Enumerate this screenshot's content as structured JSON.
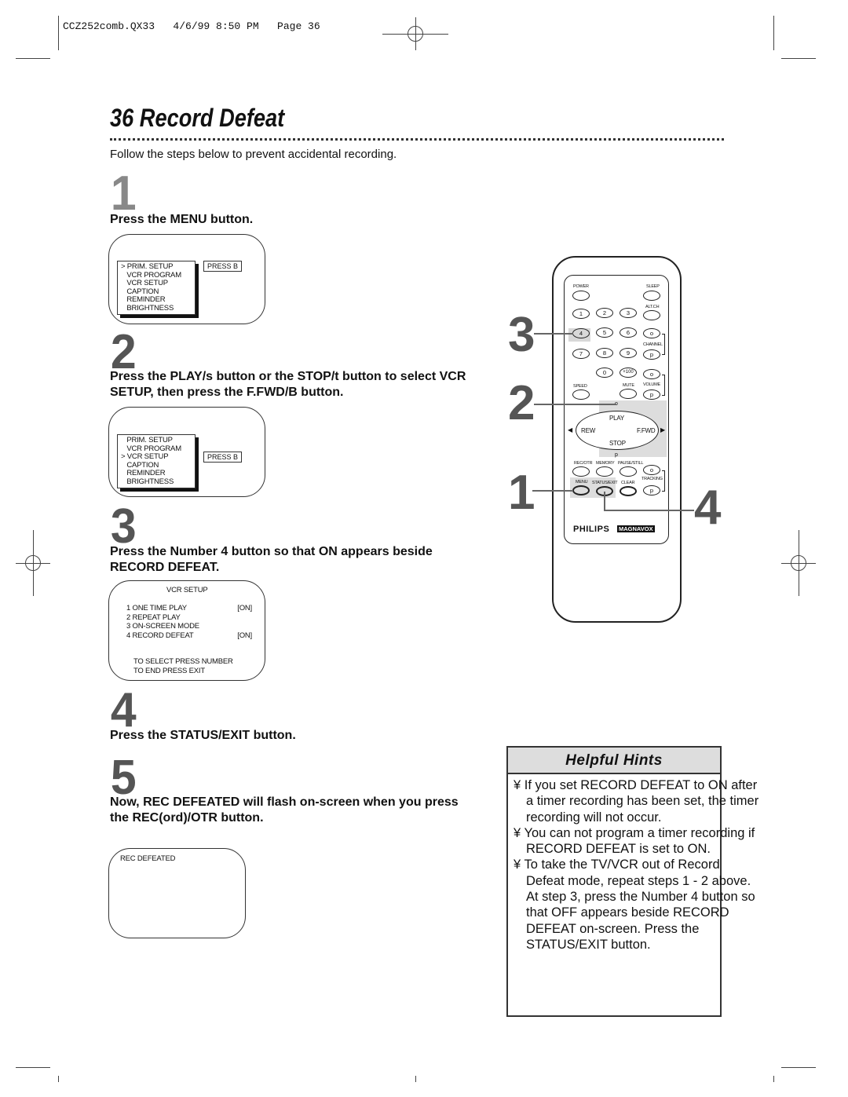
{
  "slug": "CCZ252comb.QX33   4/6/99 8:50 PM   Page 36",
  "title": "36  Record Defeat",
  "intro": "Follow the steps below to prevent accidental recording.",
  "steps": [
    {
      "num": "1",
      "text": "Press the MENU button."
    },
    {
      "num": "2",
      "text": "Press the PLAY/s  button or the STOP/t  button to select VCR SETUP, then press the F.FWD/B  button."
    },
    {
      "num": "3",
      "text": "Press the Number 4 button so that ON appears beside RECORD DEFEAT."
    },
    {
      "num": "4",
      "text": "Press the STATUS/EXIT button."
    },
    {
      "num": "5",
      "text": "Now, REC DEFEATED will flash on-screen when you press the REC(ord)/OTR button."
    }
  ],
  "screen1": {
    "items": [
      "> PRIM. SETUP",
      "   VCR PROGRAM",
      "   VCR SETUP",
      "   CAPTION",
      "   REMINDER",
      "   BRIGHTNESS"
    ],
    "press": "PRESS B"
  },
  "screen2": {
    "items": [
      "   PRIM. SETUP",
      "   VCR PROGRAM",
      "> VCR SETUP",
      "   CAPTION",
      "   REMINDER",
      "   BRIGHTNESS"
    ],
    "press": "PRESS B"
  },
  "screen3": {
    "title": "VCR SETUP",
    "rows": [
      {
        "label": "1  ONE TIME PLAY",
        "value": "[ON]"
      },
      {
        "label": "2  REPEAT PLAY",
        "value": ""
      },
      {
        "label": "3  ON-SCREEN MODE",
        "value": ""
      },
      {
        "label": "4  RECORD DEFEAT",
        "value": "[ON]"
      }
    ],
    "footer1": "TO SELECT PRESS NUMBER",
    "footer2": "TO END PRESS EXIT"
  },
  "screen5": {
    "text": "REC DEFEATED"
  },
  "hints": {
    "title": "Helpful Hints",
    "items": [
      "¥  If you set RECORD DEFEAT to ON after a timer recording has been set, the timer recording will not occur.",
      "¥  You can not program a timer recording if RECORD DEFEAT is set to ON.",
      "¥  To take the TV/VCR out of Record Defeat mode, repeat steps 1 - 2 above.  At step 3, press the Number 4 button so that OFF appears beside RECORD DEFEAT on-screen. Press the STATUS/EXIT button."
    ]
  },
  "remote": {
    "labels": {
      "power": "POWER",
      "sleep": "SLEEP",
      "altch": "ALT.CH",
      "channel": "CHANNEL",
      "speed": "SPEED",
      "mute": "MUTE",
      "volume": "VOLUME",
      "play": "PLAY",
      "rew": "REW",
      "ffwd": "F.FWD",
      "stop": "STOP",
      "recotr": "REC/OTR",
      "memory": "MEMORY",
      "pausestill": "PAUSE/STILL",
      "tracking": "TRACKING",
      "menu": "MENU",
      "statusexit": "STATUS/EXIT",
      "clear": "CLEAR",
      "up": "o",
      "down": "p"
    },
    "digits": [
      "1",
      "2",
      "3",
      "4",
      "5",
      "6",
      "7",
      "8",
      "9",
      "0",
      "+100"
    ],
    "brand": "PHILIPS",
    "brand2": "MAGNAVOX"
  },
  "callouts": [
    "3",
    "2",
    "1",
    "4"
  ]
}
